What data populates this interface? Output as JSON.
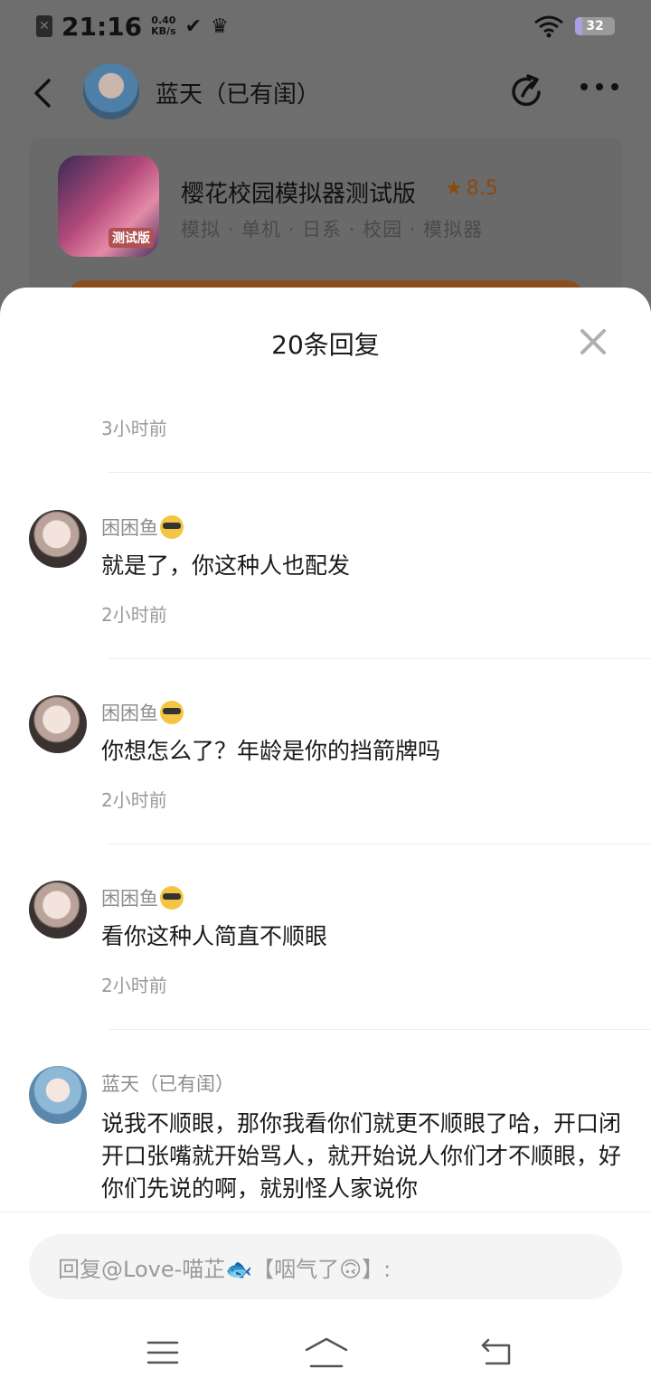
{
  "status_bar": {
    "time": "21:16",
    "net_speed_value": "0.40",
    "net_speed_unit": "KB/s",
    "battery": "32"
  },
  "nav": {
    "title": "蓝天（已有闺）"
  },
  "game_card": {
    "title": "樱花校园模拟器测试版",
    "rating": "8.5",
    "tags": "模拟 · 单机 · 日系 · 校园 · 模拟器",
    "icon_tag": "测试版"
  },
  "sheet": {
    "title": "20条回复",
    "partial_time": "3小时前",
    "comments": [
      {
        "name": "困困鱼",
        "text": "就是了，你这种人也配发",
        "time": "2小时前"
      },
      {
        "name": "困困鱼",
        "text": "你想怎么了？年龄是你的挡箭牌吗",
        "time": "2小时前"
      },
      {
        "name": "困困鱼",
        "text": "看你这种人简直不顺眼",
        "time": "2小时前"
      },
      {
        "name": "蓝天（已有闺）",
        "text": "说我不顺眼，那你我看你们就更不顺眼了哈，开口闭开口张嘴就开始骂人，就开始说人你们才不顺眼，好你们先说的啊，就别怪人家说你"
      }
    ]
  },
  "reply": {
    "placeholder": "回复@Love-喵芷🐟【咽气了🙃】:"
  },
  "colors": {
    "accent": "#8a4e1e",
    "muted_text": "#9a9a9a",
    "sheet_bg": "#ffffff",
    "dim_bg": "#6e6e6e"
  }
}
